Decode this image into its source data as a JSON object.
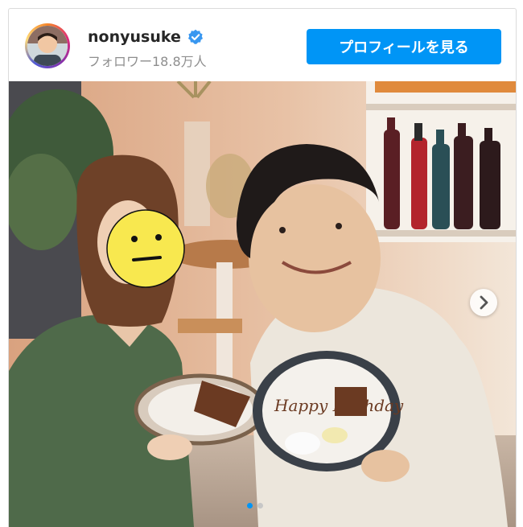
{
  "post": {
    "username": "nonyusuke",
    "followers_label": "フォロワー18.8万人",
    "profile_button_label": "プロフィールを見る",
    "verified": true,
    "carousel": {
      "current_index": 1,
      "total": 2
    },
    "plate_message": "Happy Birthday"
  },
  "icons": {
    "verified": "verified-badge-icon",
    "next": "chevron-right-icon"
  },
  "colors": {
    "accent": "#0095f6",
    "verified": "#3897f0",
    "active_dot": "#0095f6",
    "inactive_dot": "#c7c7c7"
  }
}
